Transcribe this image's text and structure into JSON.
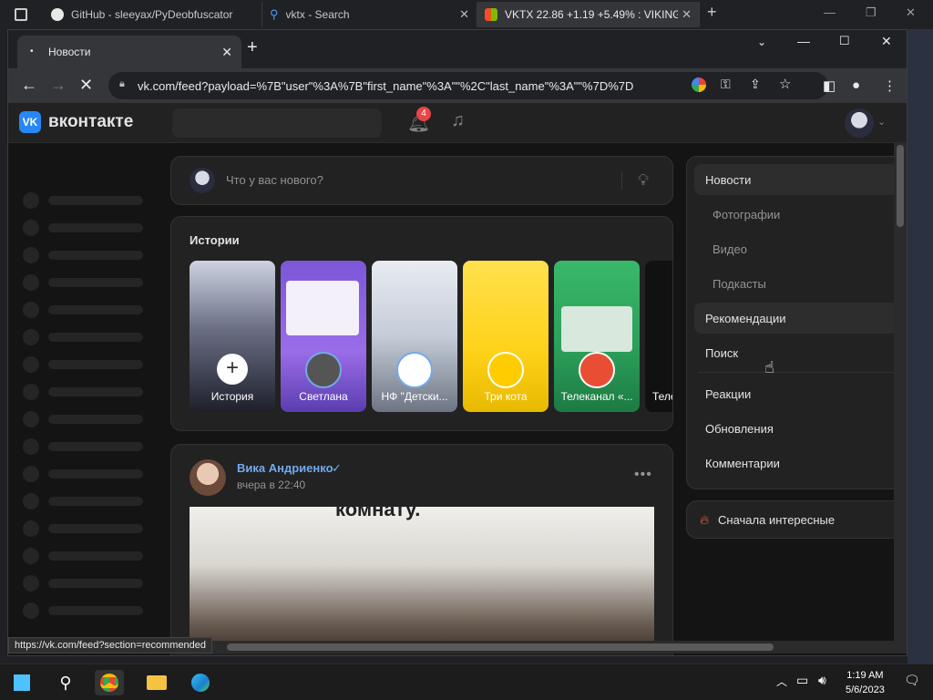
{
  "outer_tabs": [
    {
      "title": "GitHub - sleeyax/PyDeobfuscator"
    },
    {
      "title": "vktx - Search"
    },
    {
      "title": "VKTX 22.86 +1.19 +5.49% : VIKING"
    }
  ],
  "inner_window": {
    "tab_title": "Новости",
    "url": "vk.com/feed?payload=%7B\"user\"%3A%7B\"first_name\"%3A\"\"%2C\"last_name\"%3A\"\"%7D%7D"
  },
  "vk": {
    "brand": "вконтакте",
    "notifications_count": "4",
    "compose_placeholder": "Что у вас нового?",
    "stories": {
      "title": "Истории",
      "items": [
        {
          "label": "История"
        },
        {
          "label": "Светлана"
        },
        {
          "label": "НФ \"Детски..."
        },
        {
          "label": "Три кота"
        },
        {
          "label": "Телеканал «..."
        },
        {
          "label": "Теле"
        }
      ]
    },
    "post": {
      "author": "Вика Андриенко",
      "time": "вчера в 22:40",
      "image_caption": "комнату."
    },
    "menu": [
      {
        "label": "Новости",
        "active": true,
        "sub": false
      },
      {
        "label": "Фотографии",
        "sub": true
      },
      {
        "label": "Видео",
        "sub": true
      },
      {
        "label": "Подкасты",
        "sub": true
      },
      {
        "label": "Рекомендации",
        "active": true,
        "sub": false
      },
      {
        "label": "Поиск",
        "sub": false
      },
      {
        "label": "Реакции",
        "sub": false
      },
      {
        "label": "Обновления",
        "sub": false
      },
      {
        "label": "Комментарии",
        "sub": false
      }
    ],
    "sort_label": "Сначала интересные"
  },
  "status_url": "https://vk.com/feed?section=recommended",
  "taskbar": {
    "time": "1:19 AM",
    "date": "5/6/2023"
  },
  "colors": {
    "vk_blue": "#2787f5",
    "link": "#71aaeb",
    "badge": "#e64646"
  }
}
